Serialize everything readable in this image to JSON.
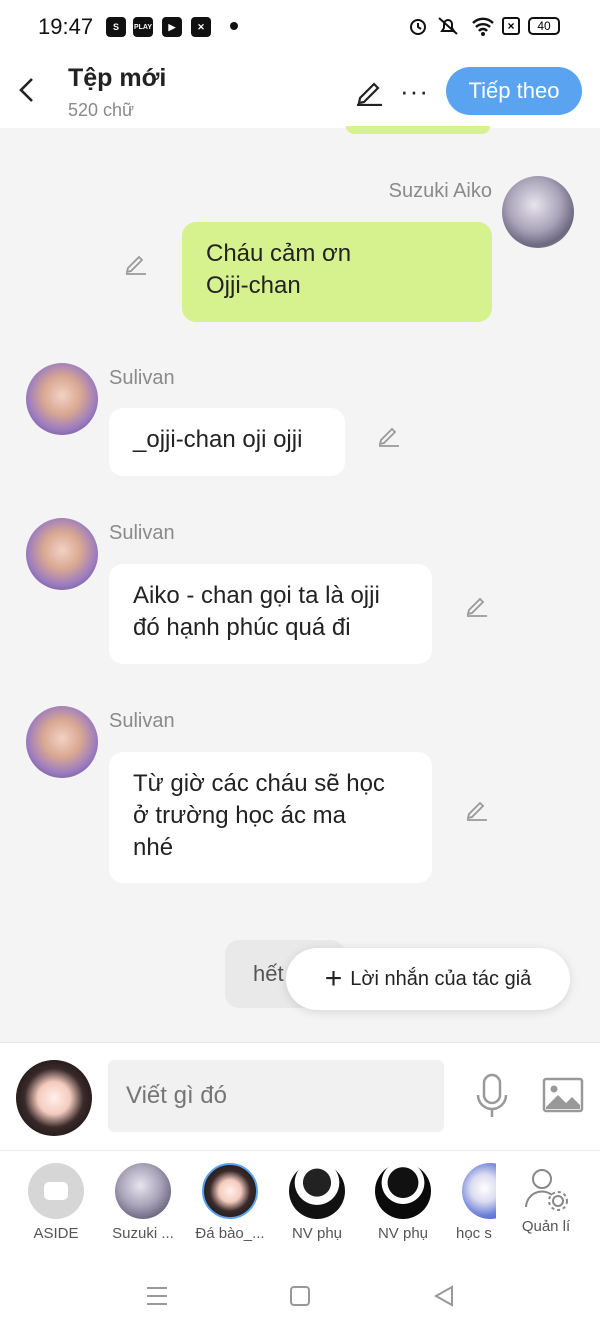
{
  "status": {
    "time": "19:47",
    "battery": "40"
  },
  "header": {
    "title": "Tệp mới",
    "subtitle": "520 chữ",
    "next_label": "Tiếp theo"
  },
  "messages": [
    {
      "sender": "Suzuki Aiko",
      "text_lines": [
        "Cháu cảm ơn",
        "Ojji-chan"
      ]
    },
    {
      "sender": "Sulivan",
      "text_lines": [
        "_ojji-chan oji ojji"
      ]
    },
    {
      "sender": "Sulivan",
      "text_lines": [
        "Aiko - chan gọi ta là ojji",
        "đó hạnh phúc quá đi"
      ]
    },
    {
      "sender": "Sulivan",
      "text_lines": [
        "Từ giờ các cháu sẽ học",
        "ở trường học ác ma",
        "nhé"
      ]
    }
  ],
  "partial_message": "hết",
  "author_note_label": "Lời nhắn của tác giả",
  "composer": {
    "placeholder": "Viết gì đó"
  },
  "characters": [
    {
      "label": "ASIDE"
    },
    {
      "label": "Suzuki ..."
    },
    {
      "label": "Đá bào_..."
    },
    {
      "label": "NV phụ"
    },
    {
      "label": "NV phụ"
    },
    {
      "label": "học s"
    },
    {
      "label": "Quản lí"
    }
  ],
  "colors": {
    "accent": "#5aa3f0",
    "own_bubble": "#d6f28e",
    "background": "#f4f4f4"
  }
}
